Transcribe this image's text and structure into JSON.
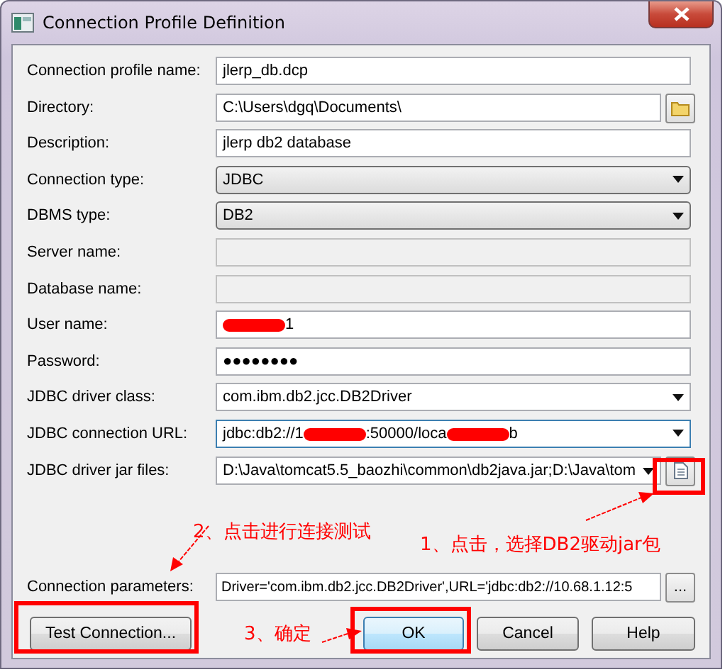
{
  "window": {
    "title": "Connection Profile Definition"
  },
  "fields": [
    {
      "label": "Connection profile name:",
      "kind": "text",
      "value": "jlerp_db.dcp"
    },
    {
      "label": "Directory:",
      "kind": "text",
      "value": "C:\\Users\\dgq\\Documents\\",
      "button": {
        "kind": "folder"
      }
    },
    {
      "label": "Description:",
      "kind": "text",
      "value": "jlerp db2 database"
    },
    {
      "label": "Connection type:",
      "kind": "combo",
      "value": "JDBC"
    },
    {
      "label": "DBMS type:",
      "kind": "combo",
      "value": "DB2"
    },
    {
      "label": "Server name:",
      "kind": "disabled"
    },
    {
      "label": "Database name:",
      "kind": "disabled"
    },
    {
      "label": "User name:",
      "kind": "text",
      "segments": [
        {
          "kind": "redacted"
        },
        {
          "kind": "text",
          "text": "1"
        }
      ]
    },
    {
      "label": "Password:",
      "kind": "password",
      "value": "●●●●●●●●"
    },
    {
      "label": "JDBC driver class:",
      "kind": "editcombo",
      "value": "com.ibm.db2.jcc.DB2Driver"
    },
    {
      "label": "JDBC connection URL:",
      "kind": "editcombo",
      "focused": true,
      "segments": [
        {
          "kind": "text",
          "text": "jdbc:db2://1"
        },
        {
          "kind": "redacted"
        },
        {
          "kind": "text",
          "text": ":50000/loca"
        },
        {
          "kind": "redacted"
        },
        {
          "kind": "text",
          "text": "b"
        }
      ]
    },
    {
      "label": "JDBC driver jar files:",
      "kind": "editcombo",
      "value": "D:\\Java\\tomcat5.5_baozhi\\common\\db2java.jar;D:\\Java\\tom",
      "button": {
        "kind": "file"
      }
    }
  ],
  "parameters": {
    "label": "Connection parameters:",
    "value": "Driver='com.ibm.db2.jcc.DB2Driver',URL='jdbc:db2://10.68.1.12:5",
    "button_label": "..."
  },
  "buttons": [
    {
      "label": "Test Connection...",
      "default": false
    },
    {
      "label": "OK",
      "default": true
    },
    {
      "label": "Cancel",
      "default": false
    },
    {
      "label": "Help",
      "default": false
    }
  ],
  "annotations": [
    {
      "text": "2、点击进行连接测试"
    },
    {
      "text": "1、点击，选择DB2驱动jar包"
    },
    {
      "text": "3、确定"
    }
  ]
}
